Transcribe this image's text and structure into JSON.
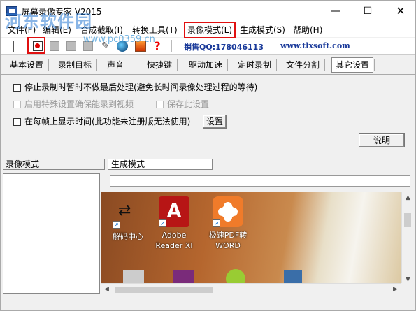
{
  "window": {
    "title": "屏幕录像专家 V2015",
    "min_glyph": "—",
    "max_glyph": "☐",
    "close_glyph": "✕"
  },
  "watermark": {
    "text": "河东软件园",
    "url": "www.pc0359.cn"
  },
  "menu": [
    {
      "label": "文件(F)",
      "highlighted": false
    },
    {
      "label": "编辑(E)",
      "highlighted": false
    },
    {
      "label": "合成截取(I)",
      "highlighted": false
    },
    {
      "label": "转换工具(T)",
      "highlighted": false
    },
    {
      "label": "录像模式(L)",
      "highlighted": true
    },
    {
      "label": "生成模式(S)",
      "highlighted": false
    },
    {
      "label": "帮助(H)",
      "highlighted": false
    }
  ],
  "toolbar": {
    "icons": [
      "new-file-icon",
      "record-icon",
      "gray-icon",
      "gray-icon",
      "gray-icon",
      "key-icon",
      "globe-icon",
      "picture-icon",
      "help-icon"
    ],
    "help_glyph": "?",
    "key_glyph": "✎",
    "sales_label": "销售QQ:178046113",
    "website": "www.tlxsoft.com"
  },
  "tabs": [
    {
      "label": "基本设置",
      "active": false
    },
    {
      "label": "录制目标",
      "active": false
    },
    {
      "label": "声音",
      "active": false
    },
    {
      "label": "快捷键",
      "active": false
    },
    {
      "label": "驱动加速",
      "active": false
    },
    {
      "label": "定时录制",
      "active": false
    },
    {
      "label": "文件分割",
      "active": false
    },
    {
      "label": "其它设置",
      "active": true
    }
  ],
  "settings": {
    "option_pause": {
      "label": "停止录制时暂时不做最后处理(避免长时间录像处理过程的等待)",
      "checked": false,
      "enabled": true
    },
    "option_special": {
      "label": "启用特殊设置确保能录到视频",
      "checked": false,
      "enabled": false
    },
    "option_save": {
      "label": "保存此设置",
      "checked": false,
      "enabled": false
    },
    "option_show_time": {
      "label": "在每帧上显示时间(此功能未注册版无法使用)",
      "checked": false,
      "enabled": true
    },
    "set_button": "设置",
    "help_button": "说明"
  },
  "lower": {
    "left_tab": "录像模式",
    "right_tab": "生成模式",
    "scroll_up": "▲",
    "scroll_down": "▼",
    "scroll_left": "◀",
    "scroll_right": "▶",
    "desktop_icons": [
      {
        "label": "解码中心",
        "icon": "decode-arrows-icon"
      },
      {
        "label": "Adobe Reader XI",
        "icon": "adobe-reader-icon"
      },
      {
        "label": "极速PDF转WORD",
        "icon": "pdf-to-word-icon"
      }
    ],
    "shortcut_glyph": "↗",
    "arrows_glyph": "⇄",
    "pdf_glyph": "A"
  }
}
